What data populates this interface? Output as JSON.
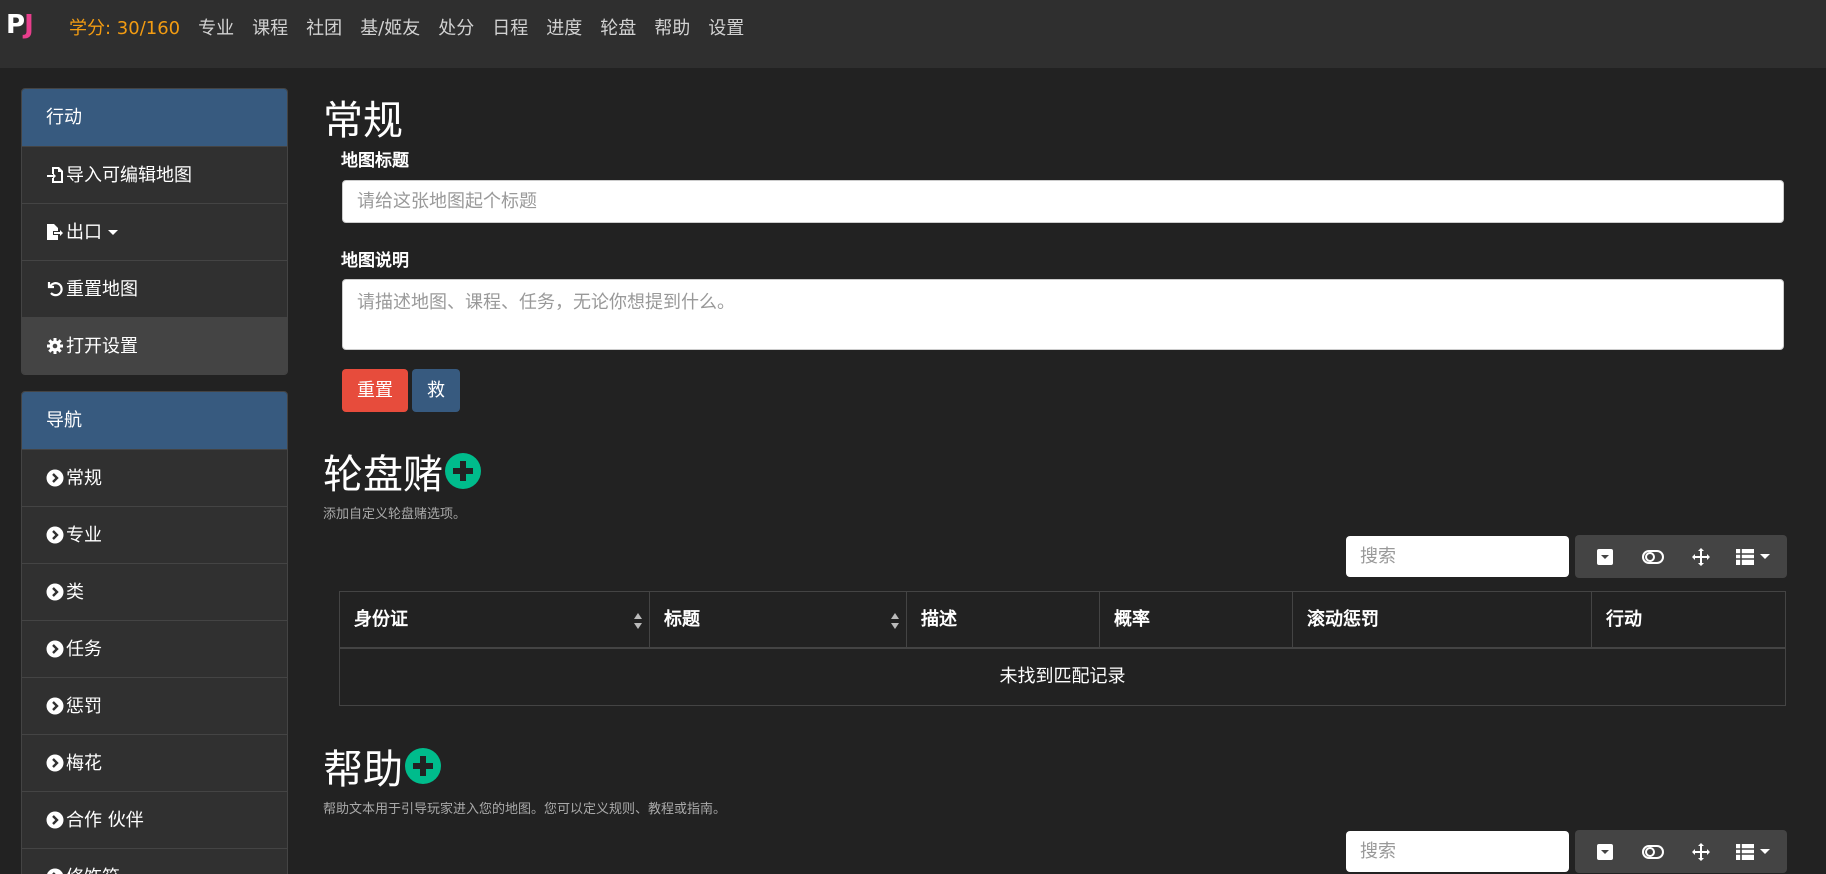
{
  "navbar": {
    "brand_p": "P",
    "brand_j": "J",
    "credits": "学分: 30/160",
    "items": [
      "专业",
      "课程",
      "社团",
      "基/姬友",
      "处分",
      "日程",
      "进度",
      "轮盘",
      "帮助",
      "设置"
    ]
  },
  "sidebar": {
    "actions": {
      "title": "行动",
      "items": [
        "导入可编辑地图",
        "出口",
        "重置地图",
        "打开设置"
      ]
    },
    "navigation": {
      "title": "导航",
      "items": [
        "常规",
        "专业",
        "类",
        "任务",
        "惩罚",
        "梅花",
        "合作 伙伴",
        "修饰符"
      ]
    }
  },
  "general": {
    "heading": "常规",
    "title_label": "地图标题",
    "title_placeholder": "请给这张地图起个标题",
    "desc_label": "地图说明",
    "desc_placeholder": "请描述地图、课程、任务，无论你想提到什么。",
    "reset_button": "重置",
    "save_button": "救"
  },
  "roulette": {
    "heading": "轮盘赌",
    "description": "添加自定义轮盘赌选项。",
    "search_placeholder": "搜索",
    "columns": [
      "身份证",
      "标题",
      "描述",
      "概率",
      "滚动惩罚",
      "行动"
    ],
    "empty_text": "未找到匹配记录"
  },
  "help": {
    "heading": "帮助",
    "description": "帮助文本用于引导玩家进入您的地图。您可以定义规则、教程或指南。",
    "search_placeholder": "搜索"
  },
  "colors": {
    "accent_primary": "#375a7f",
    "accent_success": "#00bc8c",
    "accent_danger": "#e74c3c",
    "credits": "#f39c12",
    "brand_j": "#e83e8c"
  }
}
